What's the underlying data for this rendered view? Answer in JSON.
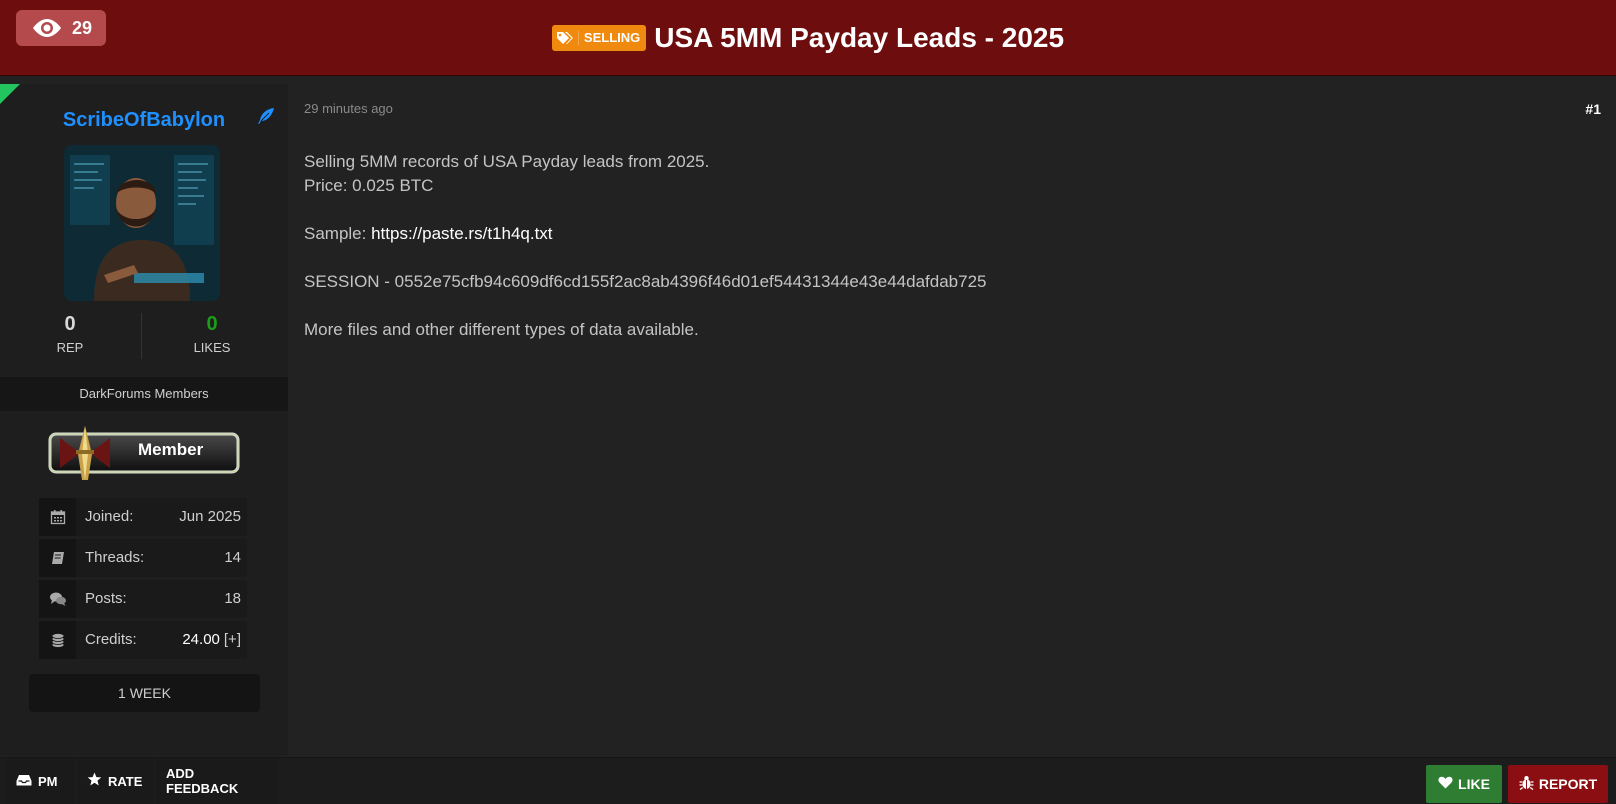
{
  "header": {
    "views_count": "29",
    "tag_label": "SELLING",
    "title": "USA 5MM Payday Leads - 2025"
  },
  "author": {
    "username": "ScribeOfBabylon",
    "rep_value": "0",
    "rep_label": "REP",
    "likes_value": "0",
    "likes_label": "LIKES",
    "group": "DarkForums Members",
    "badge_label": "Member",
    "info": [
      {
        "label": "Joined:",
        "value": "Jun 2025",
        "icon": "calendar-icon"
      },
      {
        "label": "Threads:",
        "value": "14",
        "icon": "book-icon"
      },
      {
        "label": "Posts:",
        "value": "18",
        "icon": "comments-icon"
      },
      {
        "label": "Credits:",
        "value": "24.00",
        "extra": "[+]",
        "icon": "coins-icon"
      }
    ],
    "membership_duration": "1 WEEK"
  },
  "post": {
    "timestamp": "29 minutes ago",
    "number": "#1",
    "line1": "Selling 5MM records of USA Payday leads from 2025.",
    "line2": "Price: 0.025 BTC",
    "sample_prefix": "Sample: ",
    "sample_link": "https://paste.rs/t1h4q.txt",
    "session_line": "SESSION - 0552e75cfb94c609df6cd155f2ac8ab4396f46d01ef54431344e43e44dafdab725",
    "footer_line": "More files and other different types of data available."
  },
  "actions": {
    "pm_label": "PM",
    "rate_label": "RATE",
    "feedback_label": "ADD FEEDBACK",
    "like_label": "LIKE",
    "report_label": "REPORT"
  },
  "colors": {
    "header_bg": "#6e0d0e",
    "username": "#1e90ff",
    "likes_green": "#1a9e1a",
    "like_button": "#2e7d32",
    "report_button": "#8b0f12",
    "selling_tag": "#f08a0e"
  }
}
